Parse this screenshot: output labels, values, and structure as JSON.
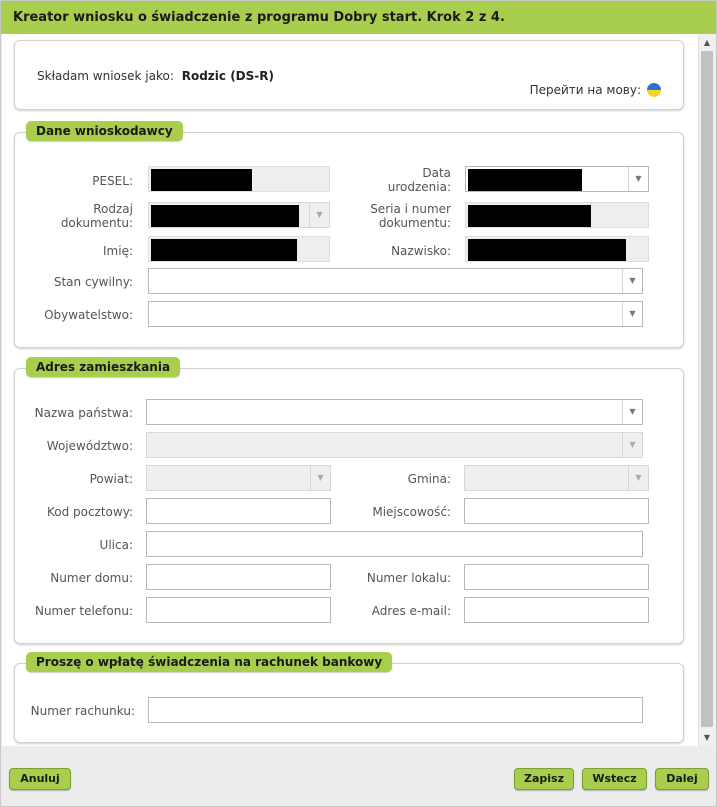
{
  "window": {
    "title": "Kreator wniosku o świadczenie z programu Dobry start. Krok 2 z 4."
  },
  "header_panel": {
    "applicant_label": "Składam wniosek jako:",
    "applicant_value": "Rodzic (DS-R)",
    "lang_label": "Перейти на мову:",
    "lang_icon": "ukraine-flag-icon"
  },
  "applicant_section": {
    "legend": "Dane wnioskodawcy",
    "pesel_label": "PESEL:",
    "birthdate_label_1": "Data",
    "birthdate_label_2": "urodzenia:",
    "doc_type_label_1": "Rodzaj",
    "doc_type_label_2": "dokumentu:",
    "doc_number_label_1": "Seria i numer",
    "doc_number_label_2": "dokumentu:",
    "first_name_label": "Imię:",
    "last_name_label": "Nazwisko:",
    "marital_label": "Stan cywilny:",
    "citizenship_label": "Obywatelstwo:"
  },
  "address_section": {
    "legend": "Adres zamieszkania",
    "country_label": "Nazwa państwa:",
    "voivodeship_label": "Województwo:",
    "county_label": "Powiat:",
    "commune_label": "Gmina:",
    "postal_label": "Kod pocztowy:",
    "city_label": "Miejscowość:",
    "street_label": "Ulica:",
    "house_label": "Numer domu:",
    "flat_label": "Numer lokalu:",
    "phone_label": "Numer telefonu:",
    "email_label": "Adres e-mail:"
  },
  "bank_section": {
    "legend": "Proszę o wpłatę świadczenia na rachunek bankowy",
    "account_label": "Numer rachunku:"
  },
  "footer": {
    "cancel": "Anuluj",
    "save": "Zapisz",
    "back": "Wstecz",
    "next": "Dalej"
  }
}
